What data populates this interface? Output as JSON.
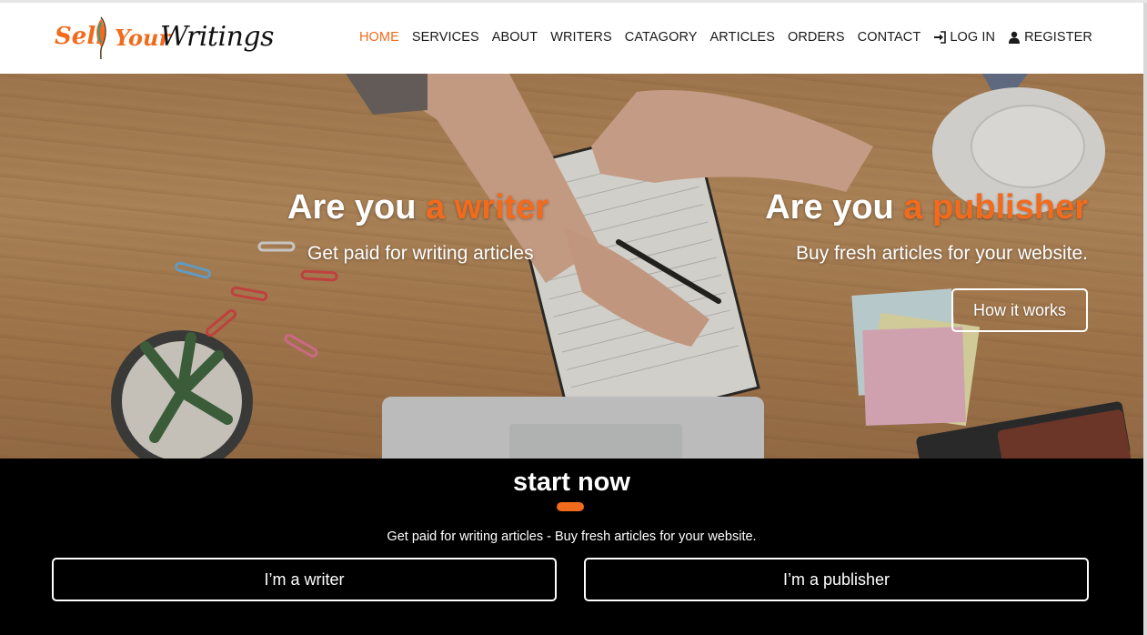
{
  "brand": {
    "sell": "Sell",
    "your": "Your",
    "writings": "Writings"
  },
  "nav": [
    {
      "label": "HOME",
      "active": true
    },
    {
      "label": "SERVICES"
    },
    {
      "label": "ABOUT"
    },
    {
      "label": "WRITERS"
    },
    {
      "label": "CATAGORY"
    },
    {
      "label": "ARTICLES"
    },
    {
      "label": "ORDERS"
    },
    {
      "label": "CONTACT"
    },
    {
      "label": "LOG IN",
      "icon": "login-icon"
    },
    {
      "label": "REGISTER",
      "icon": "user-icon"
    }
  ],
  "hero": {
    "writer": {
      "title_prefix": "Are you ",
      "title_accent": "a writer",
      "subtitle": "Get paid for writing articles"
    },
    "publisher": {
      "title_prefix": "Are you ",
      "title_accent": "a publisher",
      "subtitle": "Buy fresh articles for your website."
    },
    "how_button": "How it works"
  },
  "cta": {
    "title": "start now",
    "subtitle": "Get paid for writing articles - Buy fresh articles for your website.",
    "writer_button": "I’m a writer",
    "publisher_button": "I’m a publisher"
  },
  "colors": {
    "accent": "#f26b1d",
    "cta_bg": "#000000",
    "header_bg": "#ffffff"
  }
}
